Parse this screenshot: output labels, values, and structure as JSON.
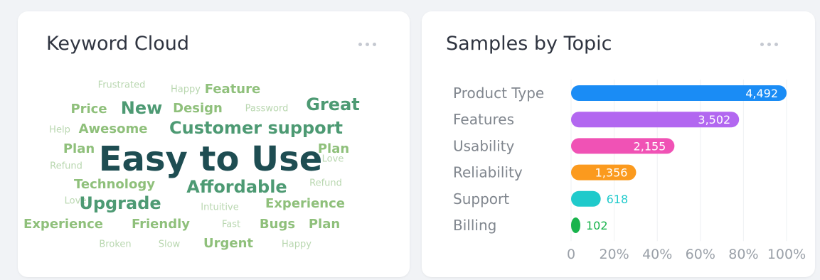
{
  "keyword_cloud": {
    "title": "Keyword Cloud",
    "words": [
      {
        "text": "Frustrated",
        "weight": 1,
        "color": "#b9d7b0"
      },
      {
        "text": "Happy",
        "weight": 1,
        "color": "#b9d7b0"
      },
      {
        "text": "Feature",
        "weight": 2,
        "color": "#8fc07b"
      },
      {
        "text": "Price",
        "weight": 2,
        "color": "#8fc07b"
      },
      {
        "text": "New",
        "weight": 3,
        "color": "#4d9a73"
      },
      {
        "text": "Design",
        "weight": 2,
        "color": "#8fc07b"
      },
      {
        "text": "Password",
        "weight": 1,
        "color": "#b9d7b0"
      },
      {
        "text": "Great",
        "weight": 3,
        "color": "#4d9a73"
      },
      {
        "text": "Help",
        "weight": 1,
        "color": "#b9d7b0"
      },
      {
        "text": "Awesome",
        "weight": 2,
        "color": "#8fc07b"
      },
      {
        "text": "Customer support",
        "weight": 3,
        "color": "#4d9a73"
      },
      {
        "text": "Plan",
        "weight": 2,
        "color": "#8fc07b"
      },
      {
        "text": "Plan",
        "weight": 2,
        "color": "#8fc07b"
      },
      {
        "text": "Easy to Use",
        "weight": 5,
        "color": "#1e4d52"
      },
      {
        "text": "Love",
        "weight": 1,
        "color": "#b9d7b0"
      },
      {
        "text": "Refund",
        "weight": 1,
        "color": "#b9d7b0"
      },
      {
        "text": "Technology",
        "weight": 2,
        "color": "#8fc07b"
      },
      {
        "text": "Affordable",
        "weight": 3,
        "color": "#4d9a73"
      },
      {
        "text": "Refund",
        "weight": 1,
        "color": "#b9d7b0"
      },
      {
        "text": "Love",
        "weight": 1,
        "color": "#b9d7b0"
      },
      {
        "text": "Upgrade",
        "weight": 3,
        "color": "#4d9a73"
      },
      {
        "text": "Intuitive",
        "weight": 1,
        "color": "#b9d7b0"
      },
      {
        "text": "Experience",
        "weight": 2,
        "color": "#8fc07b"
      },
      {
        "text": "Experience",
        "weight": 2,
        "color": "#8fc07b"
      },
      {
        "text": "Friendly",
        "weight": 2,
        "color": "#8fc07b"
      },
      {
        "text": "Fast",
        "weight": 1,
        "color": "#b9d7b0"
      },
      {
        "text": "Bugs",
        "weight": 2,
        "color": "#8fc07b"
      },
      {
        "text": "Plan",
        "weight": 2,
        "color": "#8fc07b"
      },
      {
        "text": "Broken",
        "weight": 1,
        "color": "#b9d7b0"
      },
      {
        "text": "Slow",
        "weight": 1,
        "color": "#b9d7b0"
      },
      {
        "text": "Urgent",
        "weight": 2,
        "color": "#8fc07b"
      },
      {
        "text": "Happy",
        "weight": 1,
        "color": "#b9d7b0"
      }
    ]
  },
  "chart_data": {
    "type": "bar",
    "orientation": "horizontal",
    "title": "Samples by Topic",
    "categories": [
      "Product Type",
      "Features",
      "Usability",
      "Reliability",
      "Support",
      "Billing"
    ],
    "values": [
      4492,
      3502,
      2155,
      1356,
      618,
      102
    ],
    "value_labels": [
      "4,492",
      "3,502",
      "2,155",
      "1,356",
      "618",
      "102"
    ],
    "colors": [
      "#1a8cf5",
      "#b267f0",
      "#f052b5",
      "#fb9a1e",
      "#1fcacb",
      "#18b34c"
    ],
    "x_ticks": [
      "0",
      "20%",
      "40%",
      "60%",
      "80%",
      "100%"
    ],
    "xlim": [
      0,
      4492
    ],
    "grid": true,
    "legend": "none"
  }
}
